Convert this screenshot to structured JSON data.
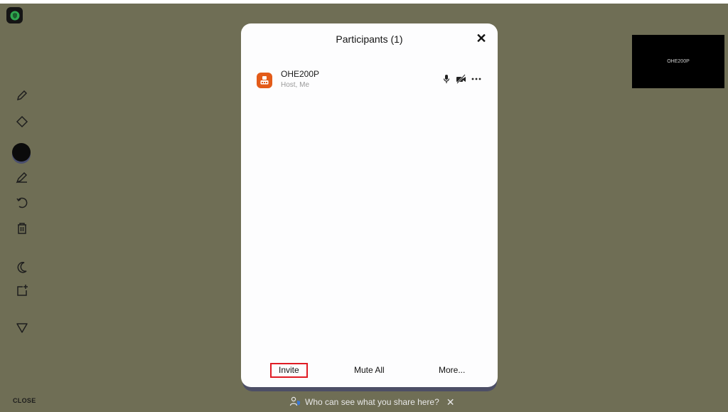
{
  "panel": {
    "title": "Participants (1)",
    "close_glyph": "✕"
  },
  "participants": [
    {
      "name": "OHE200P",
      "role": "Host, Me",
      "icons": [
        "microphone-icon",
        "video-off-icon",
        "more-icon"
      ]
    }
  ],
  "footer": {
    "invite_label": "Invite",
    "mute_all_label": "Mute All",
    "more_label": "More..."
  },
  "sidebar": {
    "tools": [
      "pencil-icon",
      "eraser-icon",
      "color-picker",
      "highlighter-icon",
      "undo-icon",
      "trash-icon",
      "dark-mode-icon",
      "add-page-icon",
      "filter-icon"
    ],
    "close_label": "CLOSE"
  },
  "video_thumb": {
    "name": "OHE200P"
  },
  "share_bar": {
    "text": "Who can see what you share here?",
    "close_glyph": "✕"
  },
  "colors": {
    "background": "#6f6e55",
    "avatar": "#e35b19",
    "invite_highlight": "#e01b24",
    "pen_color": "#0b0b0b"
  }
}
